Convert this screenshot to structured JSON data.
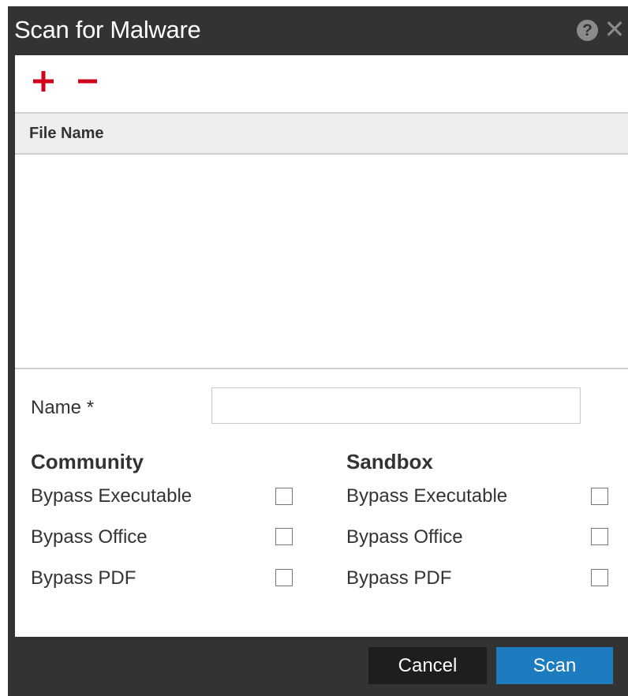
{
  "dialog": {
    "title": "Scan for Malware",
    "help_icon_glyph": "?",
    "close_icon_glyph": "✕"
  },
  "toolbar": {
    "add_icon": "plus-icon",
    "remove_icon": "minus-icon",
    "icon_color": "#d0021b"
  },
  "file_table": {
    "columns": [
      "File Name"
    ],
    "rows": []
  },
  "form": {
    "name_label": "Name *",
    "name_value": ""
  },
  "community": {
    "title": "Community",
    "options": [
      {
        "label": "Bypass Executable",
        "checked": false
      },
      {
        "label": "Bypass Office",
        "checked": false
      },
      {
        "label": "Bypass PDF",
        "checked": false
      }
    ]
  },
  "sandbox": {
    "title": "Sandbox",
    "options": [
      {
        "label": "Bypass Executable",
        "checked": false
      },
      {
        "label": "Bypass Office",
        "checked": false
      },
      {
        "label": "Bypass PDF",
        "checked": false
      }
    ]
  },
  "footer": {
    "cancel_label": "Cancel",
    "scan_label": "Scan"
  },
  "colors": {
    "chrome": "#333333",
    "primary_button": "#1d7bbf",
    "secondary_button": "#1e1e1e"
  }
}
